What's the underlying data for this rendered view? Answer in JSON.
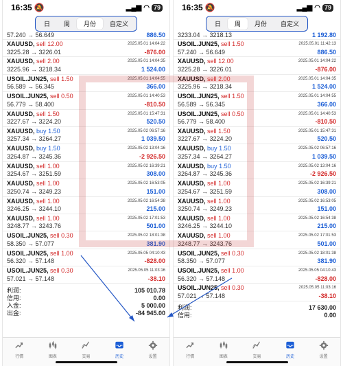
{
  "status": {
    "time": "16:35",
    "battery": "79"
  },
  "segments": [
    "日",
    "周",
    "月份",
    "自定义"
  ],
  "left": {
    "active_segment": 2,
    "top_line": {
      "prices": "57.240 → 56.649",
      "profit": "886.50"
    },
    "rows": [
      {
        "symbol": "XAUUSD,",
        "side": "sell",
        "lots": "12.00",
        "date": "2025.05.01 14:04:22",
        "prices": "3225.28 → 3226.01",
        "profit": "-876.00"
      },
      {
        "symbol": "XAUUSD,",
        "side": "sell",
        "lots": "2.00",
        "date": "2025.05.01 14:04:35",
        "prices": "3225.96 → 3218.34",
        "profit": "1 524.00"
      },
      {
        "symbol": "USOIL.JUN25,",
        "side": "sell",
        "lots": "1.50",
        "date": "2025.05.01 14:04:55",
        "prices": "56.589 → 56.345",
        "profit": "366.00"
      },
      {
        "symbol": "USOIL.JUN25,",
        "side": "sell",
        "lots": "0.50",
        "date": "2025.05.01 14:40:53",
        "prices": "56.779 → 58.400",
        "profit": "-810.50"
      },
      {
        "symbol": "XAUUSD,",
        "side": "sell",
        "lots": "1.50",
        "date": "2025.05.01 15:47:31",
        "prices": "3227.67 → 3224.20",
        "profit": "520.50"
      },
      {
        "symbol": "XAUUSD,",
        "side": "buy",
        "lots": "1.50",
        "date": "2025.05.02 06:57:16",
        "prices": "3257.34 → 3264.27",
        "profit": "1 039.50"
      },
      {
        "symbol": "XAUUSD,",
        "side": "buy",
        "lots": "1.50",
        "date": "2025.05.02 13:04:16",
        "prices": "3264.87 → 3245.36",
        "profit": "-2 926.50"
      },
      {
        "symbol": "XAUUSD,",
        "side": "sell",
        "lots": "1.00",
        "date": "2025.05.02 16:39:21",
        "prices": "3254.67 → 3251.59",
        "profit": "308.00"
      },
      {
        "symbol": "XAUUSD,",
        "side": "sell",
        "lots": "1.00",
        "date": "2025.05.02 16:53:05",
        "prices": "3250.74 → 3249.23",
        "profit": "151.00"
      },
      {
        "symbol": "XAUUSD,",
        "side": "sell",
        "lots": "1.00",
        "date": "2025.05.02 16:54:38",
        "prices": "3246.25 → 3244.10",
        "profit": "215.00"
      },
      {
        "symbol": "XAUUSD,",
        "side": "sell",
        "lots": "1.00",
        "date": "2025.05.02 17:01:53",
        "prices": "3248.77 → 3243.76",
        "profit": "501.00"
      },
      {
        "symbol": "USOIL.JUN25,",
        "side": "sell",
        "lots": "0.30",
        "date": "2025.05.02 18:01:38",
        "prices": "58.350 → 57.077",
        "profit": "381.90"
      },
      {
        "symbol": "USOIL.JUN25,",
        "side": "sell",
        "lots": "1.00",
        "date": "2025.05.05 04:10:43",
        "prices": "56.320 → 57.148",
        "profit": "-828.00"
      },
      {
        "symbol": "USOIL.JUN25,",
        "side": "sell",
        "lots": "0.30",
        "date": "2025.05.05 11:03:16",
        "prices": "57.021 → 57.148",
        "profit": "-38.10"
      }
    ],
    "summary": [
      {
        "label": "利润:",
        "value": "105 010.78"
      },
      {
        "label": "信用:",
        "value": "0.00"
      },
      {
        "label": "入金:",
        "value": "5 000.00"
      },
      {
        "label": "出金:",
        "value": "-84 945.00"
      }
    ]
  },
  "right": {
    "active_segment": 1,
    "top_line": {
      "prices": "3233.04 → 3218.13",
      "profit": "1 192.80"
    },
    "rows": [
      {
        "symbol": "USOIL.JUN25,",
        "side": "sell",
        "lots": "1.50",
        "date": "2025.05.01 11:42:13",
        "prices": "57.240 → 56.649",
        "profit": "886.50"
      },
      {
        "symbol": "XAUUSD,",
        "side": "sell",
        "lots": "12.00",
        "date": "2025.05.01 14:04:22",
        "prices": "3225.28 → 3226.01",
        "profit": "-876.00"
      },
      {
        "symbol": "XAUUSD,",
        "side": "sell",
        "lots": "2.00",
        "date": "2025.05.01 14:04:35",
        "prices": "3225.96 → 3218.34",
        "profit": "1 524.00"
      },
      {
        "symbol": "USOIL.JUN25,",
        "side": "sell",
        "lots": "1.50",
        "date": "2025.05.01 14:04:55",
        "prices": "56.589 → 56.345",
        "profit": "366.00"
      },
      {
        "symbol": "USOIL.JUN25,",
        "side": "sell",
        "lots": "0.50",
        "date": "2025.05.01 14:40:53",
        "prices": "56.779 → 58.400",
        "profit": "-810.50"
      },
      {
        "symbol": "XAUUSD,",
        "side": "sell",
        "lots": "1.50",
        "date": "2025.05.01 15:47:31",
        "prices": "3227.67 → 3224.20",
        "profit": "520.50"
      },
      {
        "symbol": "XAUUSD,",
        "side": "buy",
        "lots": "1.50",
        "date": "2025.05.02 06:57:16",
        "prices": "3257.34 → 3264.27",
        "profit": "1 039.50"
      },
      {
        "symbol": "XAUUSD,",
        "side": "buy",
        "lots": "1.50",
        "date": "2025.05.02 13:04:16",
        "prices": "3264.87 → 3245.36",
        "profit": "-2 926.50"
      },
      {
        "symbol": "XAUUSD,",
        "side": "sell",
        "lots": "1.00",
        "date": "2025.05.02 16:39:21",
        "prices": "3254.67 → 3251.59",
        "profit": "308.00"
      },
      {
        "symbol": "XAUUSD,",
        "side": "sell",
        "lots": "1.00",
        "date": "2025.05.02 16:53:05",
        "prices": "3250.74 → 3249.23",
        "profit": "151.00"
      },
      {
        "symbol": "XAUUSD,",
        "side": "sell",
        "lots": "1.00",
        "date": "2025.05.02 16:54:38",
        "prices": "3246.25 → 3244.10",
        "profit": "215.00"
      },
      {
        "symbol": "XAUUSD,",
        "side": "sell",
        "lots": "1.00",
        "date": "2025.05.02 17:01:53",
        "prices": "3248.77 → 3243.76",
        "profit": "501.00"
      },
      {
        "symbol": "USOIL.JUN25,",
        "side": "sell",
        "lots": "0.30",
        "date": "2025.05.02 18:01:38",
        "prices": "58.350 → 57.077",
        "profit": "381.90"
      },
      {
        "symbol": "USOIL.JUN25,",
        "side": "sell",
        "lots": "1.00",
        "date": "2025.05.05 04:10:43",
        "prices": "56.320 → 57.148",
        "profit": "-828.00"
      },
      {
        "symbol": "USOIL.JUN25,",
        "side": "sell",
        "lots": "0.30",
        "date": "2025.05.05 11:03:16",
        "prices": "57.021 → 57.148",
        "profit": "-38.10"
      }
    ],
    "summary": [
      {
        "label": "利润:",
        "value": "17 630.00"
      },
      {
        "label": "信用:",
        "value": "0.00"
      }
    ]
  },
  "tabs": [
    {
      "label": "行情",
      "icon": "chart-up-icon"
    },
    {
      "label": "图表",
      "icon": "candlestick-icon"
    },
    {
      "label": "交易",
      "icon": "trade-icon"
    },
    {
      "label": "历史",
      "icon": "history-inbox-icon"
    },
    {
      "label": "设置",
      "icon": "gear-icon"
    }
  ],
  "colors": {
    "sell": "#d32a2a",
    "buy": "#1d5fd6",
    "accent": "#1d5fd6",
    "highlight": "#2457c5"
  }
}
